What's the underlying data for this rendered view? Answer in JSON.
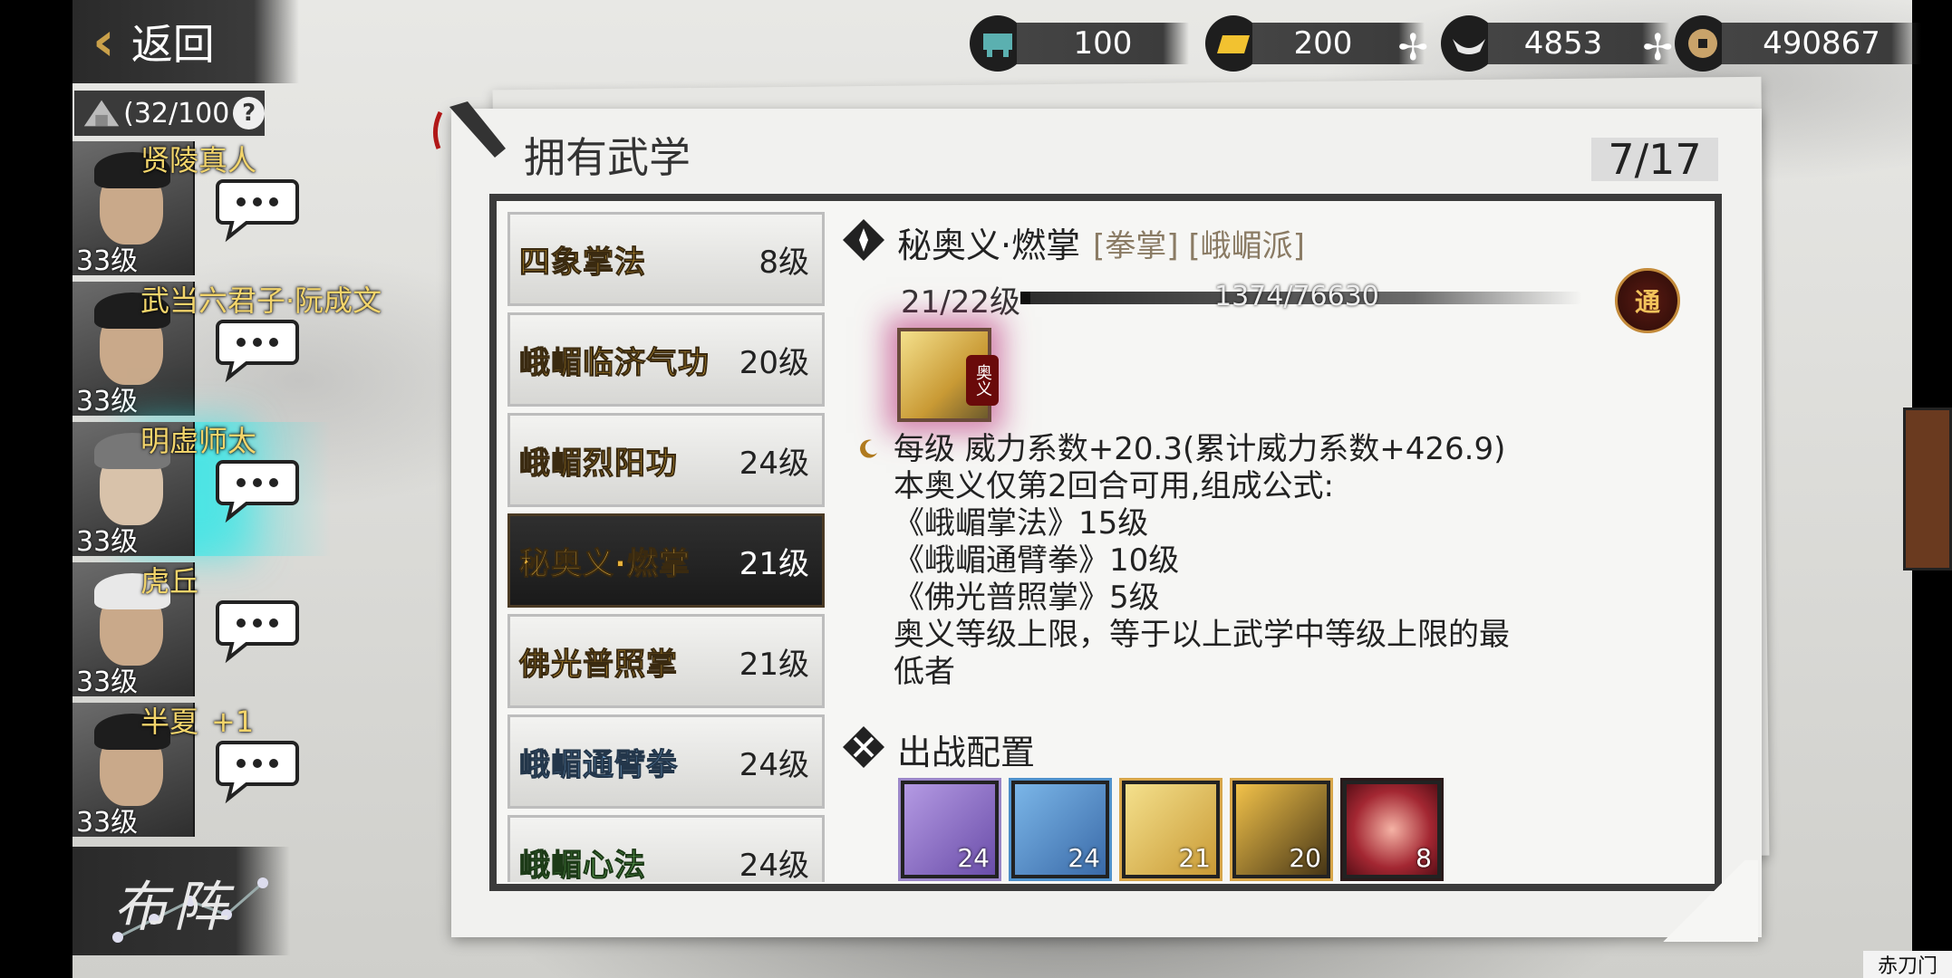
{
  "header": {
    "back_label": "返回",
    "capacity": "(32/100",
    "help": "?"
  },
  "currencies": [
    {
      "icon": "cart-icon",
      "value": "100",
      "has_plus": false
    },
    {
      "icon": "gold-ingot-icon",
      "value": "200",
      "has_plus": true
    },
    {
      "icon": "silver-ingot-icon",
      "value": "4853",
      "has_plus": true
    },
    {
      "icon": "copper-coin-icon",
      "value": "490867",
      "has_plus": false
    }
  ],
  "party": [
    {
      "name": "贤陵真人",
      "level": "33级",
      "extra": ""
    },
    {
      "name": "武当六君子·阮成文",
      "level": "33级",
      "extra": ""
    },
    {
      "name": "明虚师太",
      "level": "33级",
      "extra": ""
    },
    {
      "name": "虎丘",
      "level": "33级",
      "extra": ""
    },
    {
      "name": "半夏",
      "level": "33级",
      "extra": "+1"
    }
  ],
  "formation_label": "布阵",
  "panel": {
    "title": "拥有武学",
    "page": "7/17"
  },
  "skills": [
    {
      "name": "四象掌法",
      "level": "8级",
      "color": "gold"
    },
    {
      "name": "峨嵋临济气功",
      "level": "20级",
      "color": "gold"
    },
    {
      "name": "峨嵋烈阳功",
      "level": "24级",
      "color": "gold"
    },
    {
      "name": "秘奥义·燃掌",
      "level": "21级",
      "color": "gold"
    },
    {
      "name": "佛光普照掌",
      "level": "21级",
      "color": "gold"
    },
    {
      "name": "峨嵋通臂拳",
      "level": "24级",
      "color": "blue"
    },
    {
      "name": "峨嵋心法",
      "level": "24级",
      "color": "green"
    }
  ],
  "detail": {
    "title": "秘奥义·燃掌",
    "tags": "[拳掌] [峨嵋派]",
    "level": "21/22级",
    "exp": "1374/76630",
    "exp_fraction": 0.018,
    "badge": "通",
    "icon_badge": "奥义",
    "lines": [
      "每级  威力系数+20.3(累计威力系数+426.9)",
      "本奥义仅第2回合可用,组成公式:",
      "《峨嵋掌法》15级",
      "《峨嵋通臂拳》10级",
      "《佛光普照掌》5级",
      "奥义等级上限，等于以上武学中等级上限的最",
      "低者"
    ]
  },
  "battle": {
    "title": "出战配置",
    "slots": [
      {
        "value": "24",
        "color": "purple"
      },
      {
        "value": "24",
        "color": "blue"
      },
      {
        "value": "21",
        "color": "gold"
      },
      {
        "value": "20",
        "color": "gold2"
      },
      {
        "value": "8",
        "color": "red"
      }
    ]
  },
  "footer_text": "赤刀门",
  "colors": {
    "gold_text": "#e9b33c",
    "blue_text": "#7fb6e6",
    "green_text": "#76c86a",
    "accent_glow": "#50e6e6"
  }
}
